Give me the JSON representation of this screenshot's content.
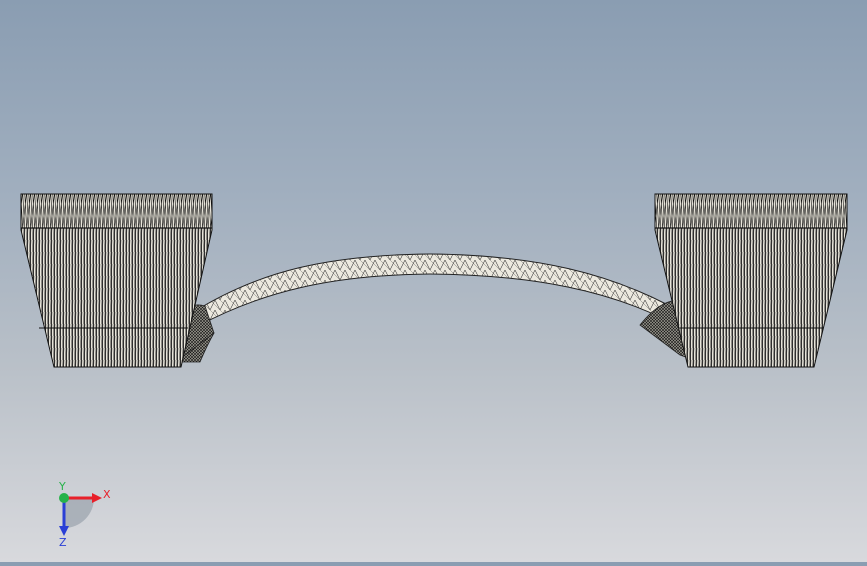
{
  "viewport": {
    "background_top": "#8a9db2",
    "background_bottom": "#d8d9dd",
    "model": {
      "name": "curved-bridge-part",
      "display_mode": "mesh-wireframe",
      "face_color": "#e6e3d8",
      "edge_color": "#111111"
    }
  },
  "triad": {
    "x_label": "X",
    "y_label": "Y",
    "z_label": "Z",
    "x_color": "#e8202a",
    "y_color": "#27b24a",
    "z_color": "#2a3fd6"
  }
}
